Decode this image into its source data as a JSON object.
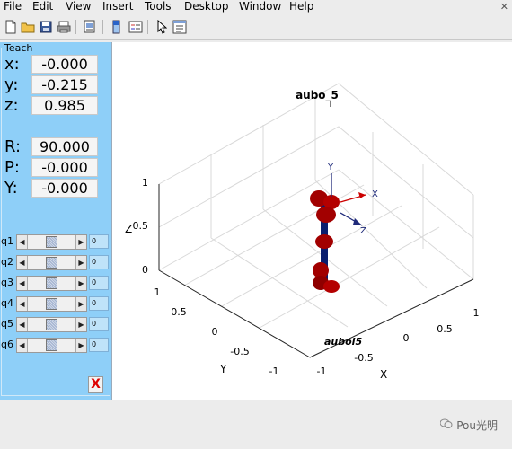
{
  "menu": {
    "items": [
      {
        "label": "File",
        "accel": "F"
      },
      {
        "label": "Edit",
        "accel": "E"
      },
      {
        "label": "View",
        "accel": "V"
      },
      {
        "label": "Insert",
        "accel": "I"
      },
      {
        "label": "Tools",
        "accel": "T"
      },
      {
        "label": "Desktop",
        "accel": "D"
      },
      {
        "label": "Window",
        "accel": "W"
      },
      {
        "label": "Help",
        "accel": "H"
      }
    ]
  },
  "toolbar": {
    "icons": [
      "new-figure-icon",
      "open-folder-icon",
      "save-icon",
      "print-icon",
      "print-preview-icon",
      "link-plot-icon",
      "insert-colorbar-icon",
      "insert-legend-icon",
      "pointer-icon",
      "property-editor-icon"
    ]
  },
  "teach": {
    "title": "Teach",
    "pose": [
      {
        "label": "x:",
        "value": "-0.000"
      },
      {
        "label": "y:",
        "value": "-0.215"
      },
      {
        "label": "z:",
        "value": "0.985"
      },
      {
        "label": "R:",
        "value": "90.000"
      },
      {
        "label": "P:",
        "value": "-0.000"
      },
      {
        "label": "Y:",
        "value": "-0.000"
      }
    ],
    "joints": [
      {
        "label": "q1",
        "value": "0"
      },
      {
        "label": "q2",
        "value": "0"
      },
      {
        "label": "q3",
        "value": "0"
      },
      {
        "label": "q4",
        "value": "0"
      },
      {
        "label": "q5",
        "value": "0"
      },
      {
        "label": "q6",
        "value": "0"
      }
    ],
    "close_label": "X"
  },
  "plot": {
    "title": "aubo_5",
    "robot_label": "auboi5",
    "axis_labels": {
      "x": "X",
      "y": "Y",
      "z": "Z"
    },
    "z_ticks": [
      "0",
      "0.5",
      "1"
    ],
    "y_ticks": [
      "1",
      "0.5",
      "0",
      "-0.5",
      "-1"
    ],
    "x_ticks": [
      "-1",
      "-0.5",
      "0",
      "0.5",
      "1"
    ],
    "frame_labels": {
      "x": "X",
      "y": "Y",
      "z": "Z"
    },
    "colors": {
      "link": "#0a1e6e",
      "joint": "#b00000",
      "axis_arrow": "#1f2a7a"
    }
  },
  "watermark": {
    "text": "Pou光明"
  }
}
